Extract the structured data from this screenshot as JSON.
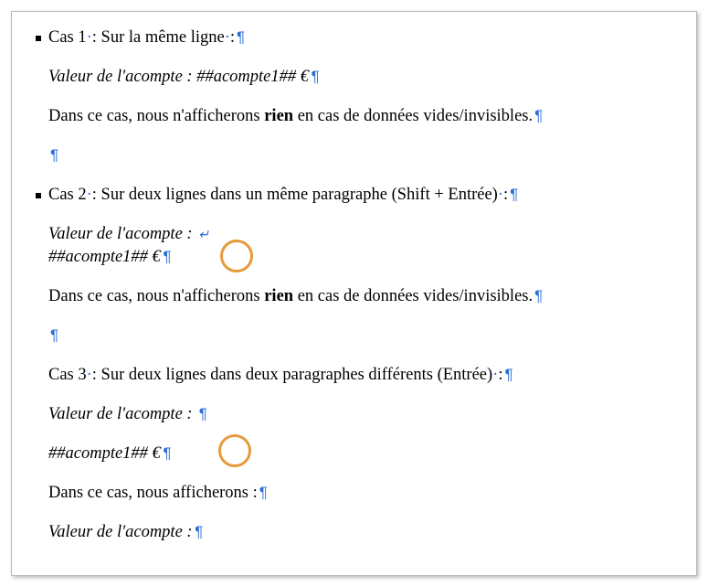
{
  "cas1": {
    "header_prefix": "Cas 1",
    "header_rest": ": Sur la même ligne",
    "line2": "Valeur de l'acompte : ##acompte1## €",
    "line3_pre": "Dans ce cas, nous n'afficherons ",
    "line3_bold": "rien",
    "line3_post": " en cas de données vides/invisibles."
  },
  "cas2": {
    "header_prefix": "Cas 2",
    "header_rest": ": Sur deux lignes dans un même paragraphe (Shift + Entrée)",
    "line2a": "Valeur de l'acompte : ",
    "line2b": "##acompte1## €",
    "line3_pre": "Dans ce cas, nous n'afficherons ",
    "line3_bold": "rien",
    "line3_post": " en cas de données vides/invisibles."
  },
  "cas3": {
    "header_prefix": "Cas 3",
    "header_rest": ": Sur deux lignes dans deux paragraphes différents (Entrée)",
    "line2": "Valeur de l'acompte : ",
    "line3": "##acompte1## €",
    "line4": "Dans ce cas, nous afficherons :",
    "line5": "Valeur de l'acompte :"
  },
  "marks": {
    "pilcrow": "¶",
    "linebreak": "↵",
    "nbsp": "·"
  }
}
